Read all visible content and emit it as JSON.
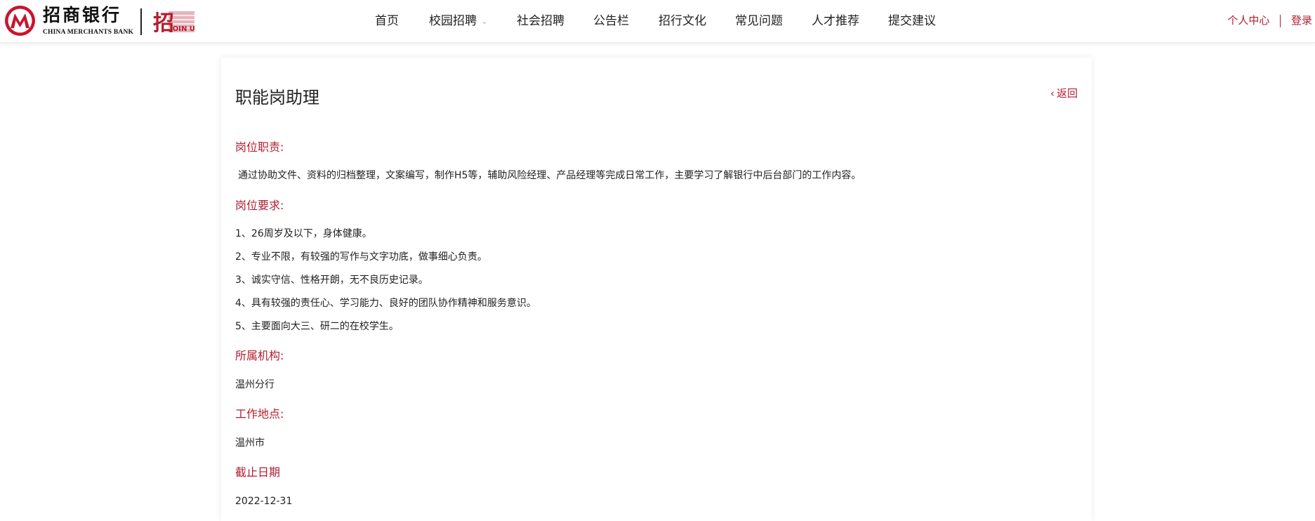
{
  "brand": {
    "name_cn": "招商银行",
    "name_en": "CHINA MERCHANTS BANK",
    "join_us_text": "JOIN US",
    "join_us_char": "招",
    "accent_color": "#b01e2f"
  },
  "nav": {
    "items": [
      {
        "label": "首页"
      },
      {
        "label": "校园招聘",
        "has_dropdown": true
      },
      {
        "label": "社会招聘"
      },
      {
        "label": "公告栏"
      },
      {
        "label": "招行文化"
      },
      {
        "label": "常见问题"
      },
      {
        "label": "人才推荐"
      },
      {
        "label": "提交建议"
      }
    ],
    "dropdown_icon": "chevron-down-icon"
  },
  "user": {
    "center_label": "个人中心",
    "login_label": "登录"
  },
  "job": {
    "title": "职能岗助理",
    "back_label": "返回",
    "back_icon": "chevron-left-icon",
    "duties_label": "岗位职责:",
    "duties_text": "通过协助文件、资料的归档整理，文案编写，制作H5等，辅助风险经理、产品经理等完成日常工作，主要学习了解银行中后台部门的工作内容。",
    "requirements_label": "岗位要求:",
    "requirements": [
      "1、26周岁及以下，身体健康。",
      "2、专业不限，有较强的写作与文字功底，做事细心负责。",
      "3、诚实守信、性格开朗，无不良历史记录。",
      "4、具有较强的责任心、学习能力、良好的团队协作精神和服务意识。",
      "5、主要面向大三、研二的在校学生。"
    ],
    "org_label": "所属机构:",
    "org_value": "温州分行",
    "location_label": "工作地点:",
    "location_value": "温州市",
    "deadline_label": "截止日期",
    "deadline_value": "2022-12-31"
  }
}
